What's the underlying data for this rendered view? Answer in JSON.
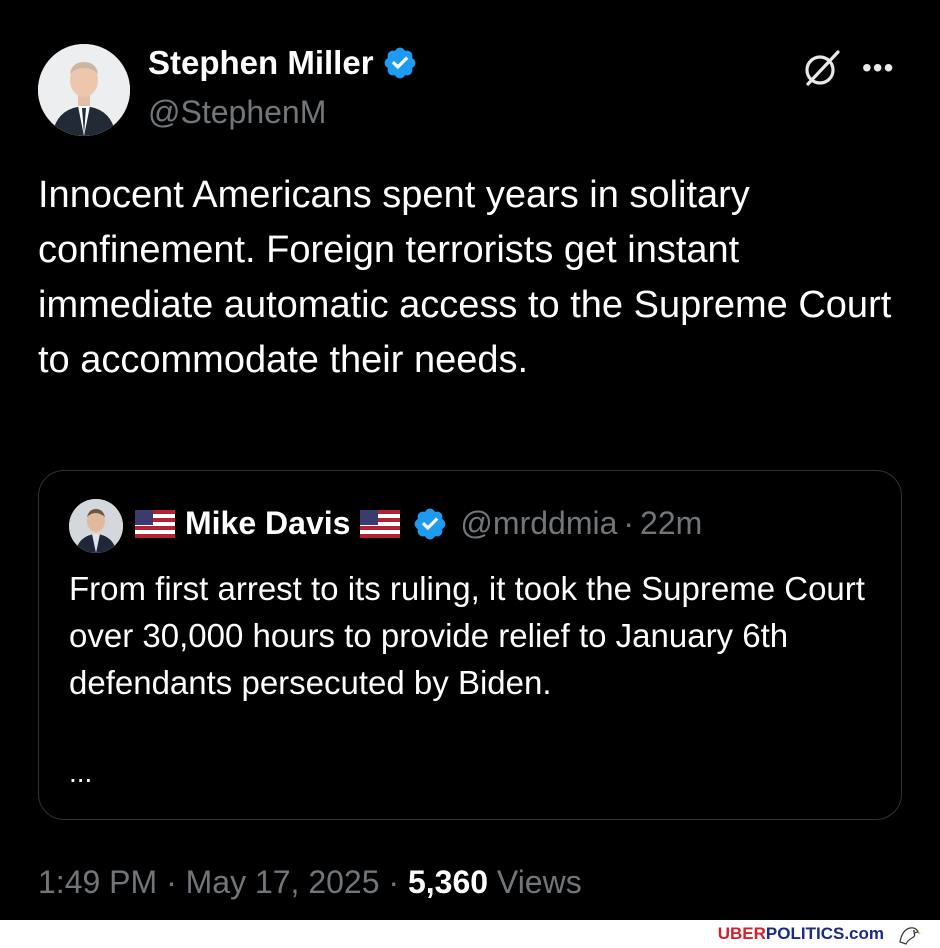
{
  "tweet": {
    "author_name": "Stephen Miller",
    "author_handle": "@StephenM",
    "text": "Innocent Americans spent years in solitary confinement. Foreign terrorists get instant immediate automatic access to the Supreme Court to accommodate their needs.",
    "time": "1:49 PM",
    "date": "May 17, 2025",
    "views_count": "5,360",
    "views_label": "Views",
    "separator": "·"
  },
  "quoted_tweet": {
    "author_name": "Mike Davis",
    "author_handle": "@mrddmia",
    "time": "22m",
    "separator": "·",
    "text": "From first arrest to its ruling, it took the Supreme Court over 30,000 hours to provide relief to January 6th defendants persecuted by Biden.",
    "truncation": "..."
  },
  "icons": {
    "verified": "verified-badge-icon",
    "grok": "grok-icon",
    "more": "more-icon",
    "flag": "us-flag-icon"
  },
  "watermark": {
    "prefix": "UBER",
    "suffix": "POLITICS.com"
  },
  "colors": {
    "background": "#000000",
    "text": "#e7e9ea",
    "secondary": "#71767b",
    "verified": "#1d9bf0",
    "border": "#2f3336"
  }
}
